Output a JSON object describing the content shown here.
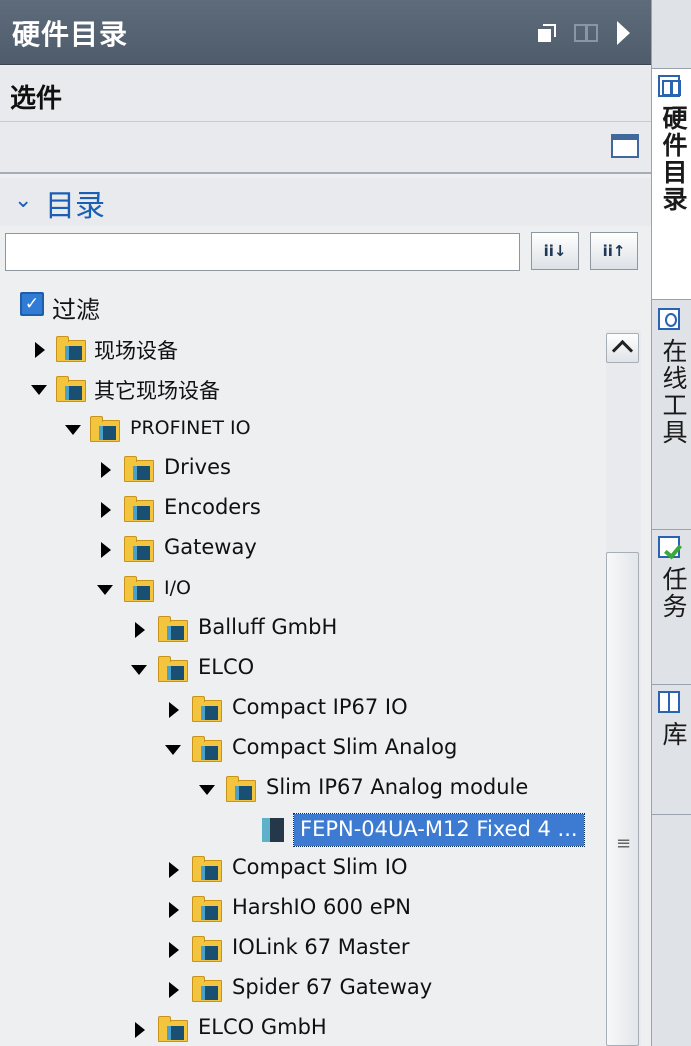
{
  "window": {
    "title": "硬件目录"
  },
  "options": {
    "title": "选件"
  },
  "catalog": {
    "title": "目录",
    "search": {
      "value": "",
      "placeholder": ""
    },
    "sort_down_label": "ii↓",
    "sort_up_label": "ii↑",
    "filter": {
      "label": "过滤",
      "checked": true
    }
  },
  "tree": {
    "nodes": [
      {
        "label": "现场设备",
        "expanded": false,
        "icon": "folder-device-icon"
      },
      {
        "label": "其它现场设备",
        "expanded": true,
        "icon": "folder-device-icon"
      },
      {
        "label": "PROFINET IO",
        "expanded": true,
        "icon": "folder-device-icon"
      },
      {
        "label": "Drives",
        "expanded": false,
        "icon": "folder-device-icon"
      },
      {
        "label": "Encoders",
        "expanded": false,
        "icon": "folder-device-icon"
      },
      {
        "label": "Gateway",
        "expanded": false,
        "icon": "folder-device-icon"
      },
      {
        "label": "I/O",
        "expanded": true,
        "icon": "folder-device-icon"
      },
      {
        "label": "Balluff GmbH",
        "expanded": false,
        "icon": "folder-device-icon"
      },
      {
        "label": "ELCO",
        "expanded": true,
        "icon": "folder-device-icon"
      },
      {
        "label": "Compact IP67 IO",
        "expanded": false,
        "icon": "folder-device-icon"
      },
      {
        "label": "Compact Slim Analog",
        "expanded": true,
        "icon": "folder-device-icon"
      },
      {
        "label": "Slim IP67 Analog module",
        "expanded": true,
        "icon": "folder-device-icon"
      },
      {
        "label": "FEPN-04UA-M12 Fixed 4 ...",
        "selected": true,
        "icon": "module-icon"
      },
      {
        "label": "Compact Slim IO",
        "expanded": false,
        "icon": "folder-device-icon"
      },
      {
        "label": "HarshIO 600 ePN",
        "expanded": false,
        "icon": "folder-device-icon"
      },
      {
        "label": "IOLink 67 Master",
        "expanded": false,
        "icon": "folder-device-icon"
      },
      {
        "label": "Spider 67 Gateway",
        "expanded": false,
        "icon": "folder-device-icon"
      },
      {
        "label": "ELCO GmbH",
        "expanded": false,
        "icon": "folder-device-icon"
      }
    ]
  },
  "side_tabs": [
    {
      "label": "硬件目录",
      "icon": "hardware-catalog-icon",
      "active": true
    },
    {
      "label": "在线工具",
      "icon": "online-tools-icon",
      "active": false
    },
    {
      "label": "任务",
      "icon": "tasks-icon",
      "active": false
    },
    {
      "label": "库",
      "icon": "libraries-icon",
      "active": false
    }
  ],
  "colors": {
    "title_bar": "#56636f",
    "accent": "#1b5fb5",
    "selection": "#3d7bd2",
    "folder": "#f3c53f"
  }
}
